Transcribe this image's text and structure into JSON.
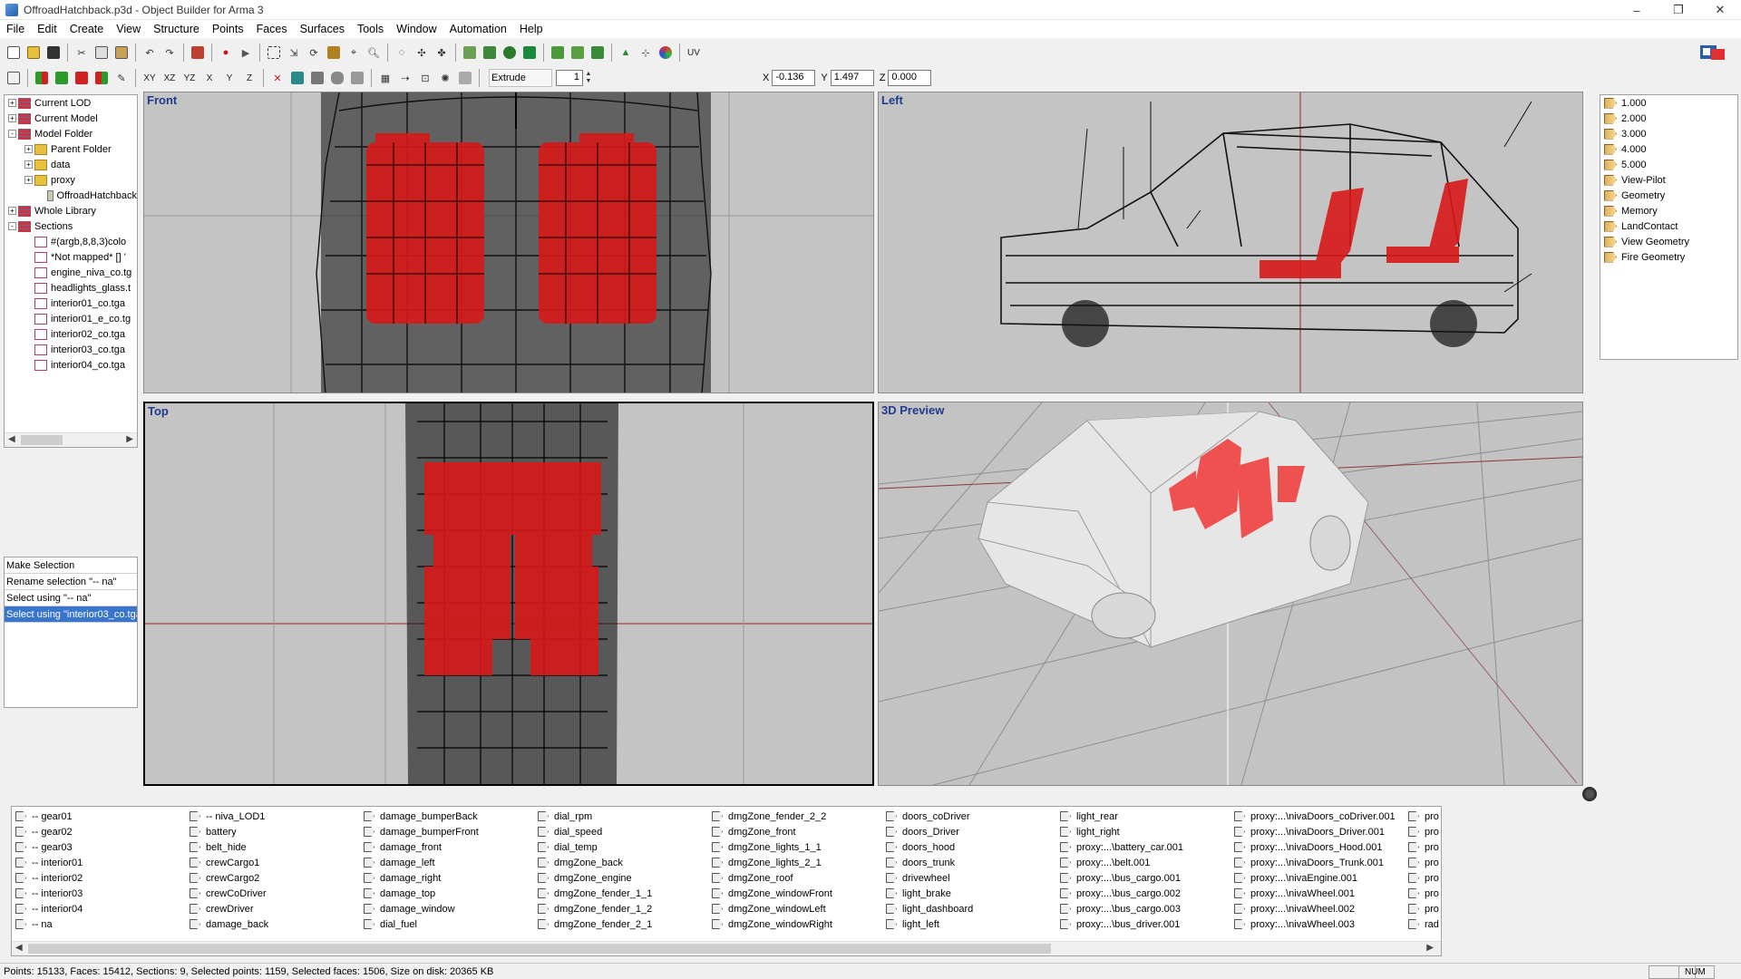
{
  "window": {
    "title": "OffroadHatchback.p3d - Object Builder for Arma 3"
  },
  "menu": [
    "File",
    "Edit",
    "Create",
    "View",
    "Structure",
    "Points",
    "Faces",
    "Surfaces",
    "Tools",
    "Window",
    "Automation",
    "Help"
  ],
  "toolbar": {
    "axis_labels": [
      "XY",
      "XZ",
      "YZ",
      "X",
      "Y",
      "Z"
    ],
    "uv_label": "UV",
    "extrude_label": "Extrude",
    "extrude_value": "1",
    "coords": {
      "x_label": "X",
      "x": "-0.136",
      "y_label": "Y",
      "y": "1.497",
      "z_label": "Z",
      "z": "0.000"
    }
  },
  "tree": [
    {
      "label": "Current LOD",
      "exp": "+",
      "indent": 0,
      "icon": "stack"
    },
    {
      "label": "Current Model",
      "exp": "+",
      "indent": 0,
      "icon": "stack"
    },
    {
      "label": "Model Folder",
      "exp": "-",
      "indent": 0,
      "icon": "stack"
    },
    {
      "label": "Parent Folder",
      "exp": "+",
      "indent": 1,
      "icon": "folder"
    },
    {
      "label": "data",
      "exp": "+",
      "indent": 1,
      "icon": "folder"
    },
    {
      "label": "proxy",
      "exp": "+",
      "indent": 1,
      "icon": "folder"
    },
    {
      "label": "OffroadHatchback",
      "exp": "",
      "indent": 2,
      "icon": "model"
    },
    {
      "label": "Whole Library",
      "exp": "+",
      "indent": 0,
      "icon": "stack"
    },
    {
      "label": "Sections",
      "exp": "-",
      "indent": 0,
      "icon": "stack"
    },
    {
      "label": "#(argb,8,8,3)colo",
      "exp": "",
      "indent": 1,
      "icon": "tex"
    },
    {
      "label": "*Not mapped* [] '",
      "exp": "",
      "indent": 1,
      "icon": "tex"
    },
    {
      "label": "engine_niva_co.tg",
      "exp": "",
      "indent": 1,
      "icon": "tex"
    },
    {
      "label": "headlights_glass.t",
      "exp": "",
      "indent": 1,
      "icon": "tex"
    },
    {
      "label": "interior01_co.tga",
      "exp": "",
      "indent": 1,
      "icon": "tex"
    },
    {
      "label": "interior01_e_co.tg",
      "exp": "",
      "indent": 1,
      "icon": "tex"
    },
    {
      "label": "interior02_co.tga",
      "exp": "",
      "indent": 1,
      "icon": "tex"
    },
    {
      "label": "interior03_co.tga",
      "exp": "",
      "indent": 1,
      "icon": "tex"
    },
    {
      "label": "interior04_co.tga",
      "exp": "",
      "indent": 1,
      "icon": "tex"
    }
  ],
  "selection_panel": [
    "Make Selection",
    "Rename selection \"-- na\"",
    "Select using \"-- na\"",
    "Select using \"interior03_co.tga\""
  ],
  "viewports": {
    "front": "Front",
    "left": "Left",
    "top": "Top",
    "preview": "3D Preview"
  },
  "lods": [
    "1.000",
    "2.000",
    "3.000",
    "4.000",
    "5.000",
    "View-Pilot",
    "Geometry",
    "Memory",
    "LandContact",
    "View Geometry",
    "Fire Geometry"
  ],
  "named_selections": [
    [
      "-- gear01",
      "-- gear02",
      "-- gear03",
      "-- interior01",
      "-- interior02",
      "-- interior03",
      "-- interior04",
      "-- na"
    ],
    [
      "-- niva_LOD1",
      "battery",
      "belt_hide",
      "crewCargo1",
      "crewCargo2",
      "crewCoDriver",
      "crewDriver",
      "damage_back"
    ],
    [
      "damage_bumperBack",
      "damage_bumperFront",
      "damage_front",
      "damage_left",
      "damage_right",
      "damage_top",
      "damage_window",
      "dial_fuel"
    ],
    [
      "dial_rpm",
      "dial_speed",
      "dial_temp",
      "dmgZone_back",
      "dmgZone_engine",
      "dmgZone_fender_1_1",
      "dmgZone_fender_1_2",
      "dmgZone_fender_2_1"
    ],
    [
      "dmgZone_fender_2_2",
      "dmgZone_front",
      "dmgZone_lights_1_1",
      "dmgZone_lights_2_1",
      "dmgZone_roof",
      "dmgZone_windowFront",
      "dmgZone_windowLeft",
      "dmgZone_windowRight"
    ],
    [
      "doors_coDriver",
      "doors_Driver",
      "doors_hood",
      "doors_trunk",
      "drivewheel",
      "light_brake",
      "light_dashboard",
      "light_left"
    ],
    [
      "light_rear",
      "light_right",
      "proxy:...\\battery_car.001",
      "proxy:...\\belt.001",
      "proxy:...\\bus_cargo.001",
      "proxy:...\\bus_cargo.002",
      "proxy:...\\bus_cargo.003",
      "proxy:...\\bus_driver.001"
    ],
    [
      "proxy:...\\nivaDoors_coDriver.001",
      "proxy:...\\nivaDoors_Driver.001",
      "proxy:...\\nivaDoors_Hood.001",
      "proxy:...\\nivaDoors_Trunk.001",
      "proxy:...\\nivaEngine.001",
      "proxy:...\\nivaWheel.001",
      "proxy:...\\nivaWheel.002",
      "proxy:...\\nivaWheel.003"
    ],
    [
      "pro",
      "pro",
      "pro",
      "pro",
      "pro",
      "pro",
      "pro",
      "rad"
    ]
  ],
  "status": {
    "text": "Points: 15133, Faces: 15412, Sections: 9, Selected points: 1159, Selected faces: 1506, Size on disk: 20365 KB",
    "num": "NUM"
  },
  "colors": {
    "selection": "#3a75cd",
    "viewport_title": "#1f3b8f",
    "highlight_red": "#e02020"
  }
}
